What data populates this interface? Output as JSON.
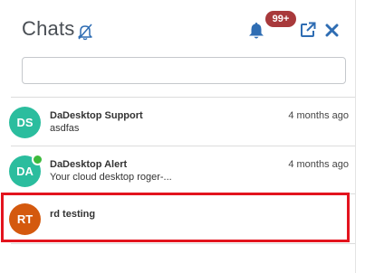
{
  "header": {
    "title": "Chats",
    "notification_count": "99+"
  },
  "search": {
    "value": "",
    "placeholder": ""
  },
  "chats": [
    {
      "initials": "DS",
      "name": "DaDesktop Support",
      "time": "4 months ago",
      "preview": "asdfas",
      "avatar_color": "#2bbd9e",
      "online": false
    },
    {
      "initials": "DA",
      "name": "DaDesktop Alert",
      "time": "4 months ago",
      "preview": "Your cloud desktop roger-...",
      "avatar_color": "#2bbd9e",
      "online": true
    },
    {
      "initials": "RT",
      "name": "rd testing",
      "time": "",
      "preview": "",
      "avatar_color": "#d4590e",
      "online": false
    }
  ],
  "colors": {
    "accent_blue": "#2f6db3",
    "badge": "#a8393b",
    "highlight_border": "#e3141e",
    "online": "#3cba3c"
  },
  "icons": {
    "mute": "bell-slash-icon",
    "notifications": "bell-icon",
    "popout": "external-link-icon",
    "close": "close-icon"
  }
}
